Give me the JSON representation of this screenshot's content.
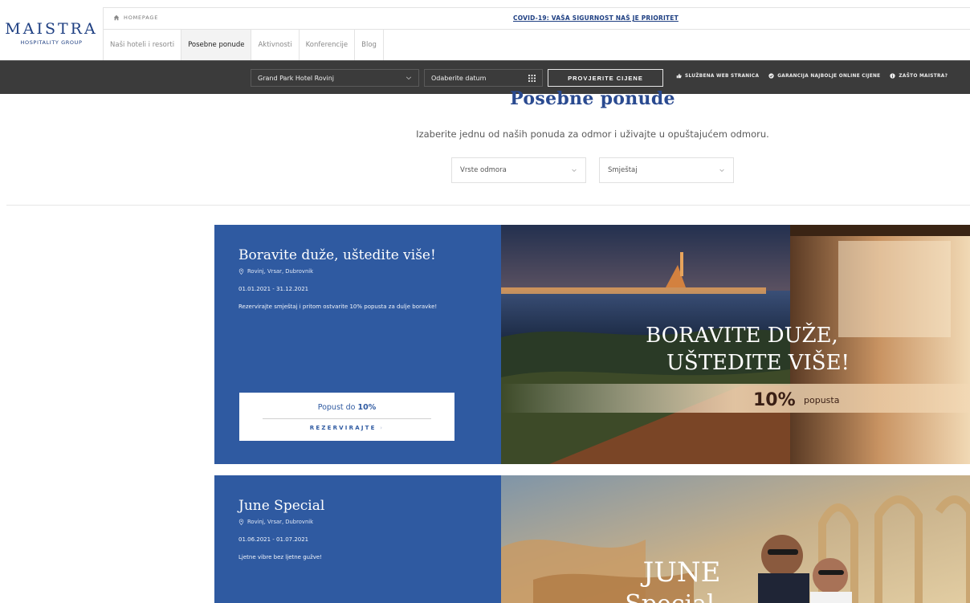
{
  "logo": {
    "name": "MAISTRA",
    "subtitle": "HOSPITALITY GROUP"
  },
  "topbar": {
    "breadcrumb": "HOMEPAGE",
    "covid_link": "COVID-19: VAŠA SIGURNOST NAŠ JE PRIORITET"
  },
  "nav": {
    "items": [
      {
        "label": "Naši hoteli i resorti",
        "active": false
      },
      {
        "label": "Posebne ponude",
        "active": true
      },
      {
        "label": "Aktivnosti",
        "active": false
      },
      {
        "label": "Konferencije",
        "active": false
      },
      {
        "label": "Blog",
        "active": false
      }
    ]
  },
  "booking": {
    "hotel": "Grand Park Hotel Rovinj",
    "date_placeholder": "Odaberite datum",
    "check_button": "PROVJERITE CIJENE",
    "links": [
      {
        "icon": "thumbs-up-icon",
        "label": "SLUŽBENA WEB STRANICA"
      },
      {
        "icon": "check-circle-icon",
        "label": "GARANCIJA NAJBOLJE ONLINE CIJENE"
      },
      {
        "icon": "info-icon",
        "label": "ZAŠTO MAISTRA?"
      }
    ]
  },
  "main": {
    "title": "Posebne ponude",
    "subtitle": "Izaberite jednu od naših ponuda za odmor i uživajte u opuštajućem odmoru.",
    "filters": {
      "holiday_type": "Vrste odmora",
      "accommodation": "Smještaj"
    }
  },
  "offers": [
    {
      "title": "Boravite duže, uštedite više!",
      "locations": "Rovinj, Vrsar, Dubrovnik",
      "dates": "01.01.2021 - 31.12.2021",
      "description": "Rezervirajte smještaj i pritom ostvarite 10% popusta za dulje boravke!",
      "promo_prefix": "Popust do",
      "promo_value": "10%",
      "cta": "REZERVIRAJTE",
      "image_text": {
        "line1": "BORAVITE DUŽE,",
        "line2": "UŠTEDITE VIŠE!",
        "discount": "10%",
        "discount_word": "popusta"
      }
    },
    {
      "title": "June Special",
      "locations": "Rovinj, Vrsar, Dubrovnik",
      "dates": "01.06.2021 - 01.07.2021",
      "description": "Ljetne vibre bez ljetne gužve!",
      "image_text": {
        "line1": "JUNE",
        "line2": "Special"
      }
    }
  ],
  "colors": {
    "brand_blue": "#2f5aa1",
    "logo_blue": "#1e3f82",
    "booking_bar": "#3b3b3b"
  }
}
